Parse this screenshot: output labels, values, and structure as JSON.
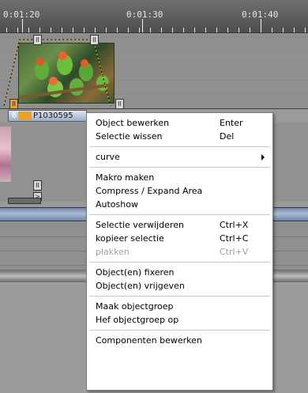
{
  "ruler": {
    "labels": [
      "0:01:20",
      "0:01:30",
      "0:01:40"
    ]
  },
  "clip": {
    "number": "6",
    "name": "P1030595"
  },
  "handles": {
    "top_left": "II",
    "top_right": "II",
    "bottom_left": "II",
    "bottom_right": "II",
    "lower": "II",
    "lower2": ">"
  },
  "menu": {
    "groups": [
      [
        {
          "label": "Object bewerken",
          "shortcut": "Enter",
          "disabled": false
        },
        {
          "label": "Selectie wissen",
          "shortcut": "Del",
          "disabled": false
        }
      ],
      [
        {
          "label": "curve",
          "shortcut": "",
          "submenu": true,
          "disabled": false
        }
      ],
      [
        {
          "label": "Makro maken",
          "shortcut": "",
          "disabled": false
        },
        {
          "label": "Compress / Expand Area",
          "shortcut": "",
          "disabled": false
        },
        {
          "label": "Autoshow",
          "shortcut": "",
          "disabled": false
        }
      ],
      [
        {
          "label": "Selectie verwijderen",
          "shortcut": "Ctrl+X",
          "disabled": false
        },
        {
          "label": "kopieer selectie",
          "shortcut": "Ctrl+C",
          "disabled": false
        },
        {
          "label": "plakken",
          "shortcut": "Ctrl+V",
          "disabled": true
        }
      ],
      [
        {
          "label": "Object(en) fixeren",
          "shortcut": "",
          "disabled": false
        },
        {
          "label": "Object(en) vrijgeven",
          "shortcut": "",
          "disabled": false
        }
      ],
      [
        {
          "label": "Maak objectgroep",
          "shortcut": "",
          "disabled": false
        },
        {
          "label": "Hef objectgroep op",
          "shortcut": "",
          "disabled": false
        }
      ],
      [
        {
          "label": "Componenten bewerken",
          "shortcut": "",
          "disabled": false
        }
      ]
    ]
  }
}
